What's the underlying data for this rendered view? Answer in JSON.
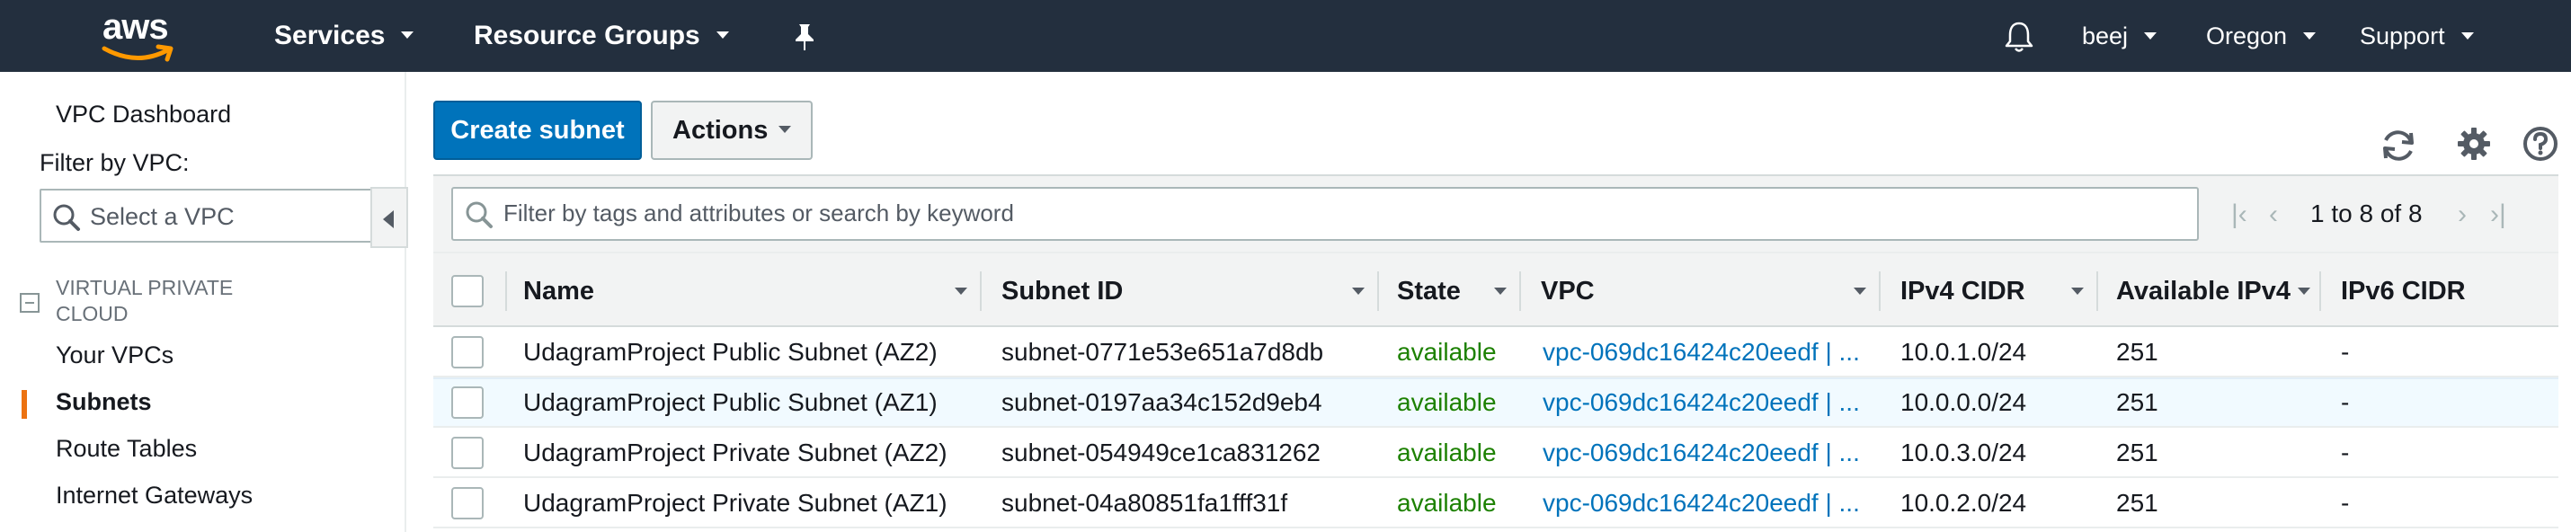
{
  "topnav": {
    "logo_text": "aws",
    "services": "Services",
    "resource_groups": "Resource Groups",
    "user": "beej",
    "region": "Oregon",
    "support": "Support",
    "pin_icon": "pushpin-icon",
    "bell_icon": "bell-icon"
  },
  "sidebar": {
    "dashboard": "VPC Dashboard",
    "filter_label": "Filter by VPC:",
    "vpc_select_placeholder": "Select a VPC",
    "section_title": "VIRTUAL PRIVATE CLOUD",
    "items": [
      {
        "label": "Your VPCs",
        "active": false
      },
      {
        "label": "Subnets",
        "active": true
      },
      {
        "label": "Route Tables",
        "active": false
      },
      {
        "label": "Internet Gateways",
        "active": false
      }
    ]
  },
  "toolbar": {
    "create_label": "Create subnet",
    "actions_label": "Actions",
    "icons": [
      "refresh-icon",
      "settings-gear-icon",
      "help-icon"
    ]
  },
  "filter": {
    "placeholder": "Filter by tags and attributes or search by keyword",
    "pagination": "1 to 8 of 8"
  },
  "table": {
    "columns": [
      "Name",
      "Subnet ID",
      "State",
      "VPC",
      "IPv4 CIDR",
      "Available IPv4 ...",
      "IPv6 CIDR"
    ],
    "rows": [
      {
        "name": "UdagramProject Public Subnet (AZ2)",
        "subnet_id": "subnet-0771e53e651a7d8db",
        "state": "available",
        "vpc": "vpc-069dc16424c20eedf | ...",
        "ipv4": "10.0.1.0/24",
        "available": "251",
        "ipv6": "-"
      },
      {
        "name": "UdagramProject Public Subnet (AZ1)",
        "subnet_id": "subnet-0197aa34c152d9eb4",
        "state": "available",
        "vpc": "vpc-069dc16424c20eedf | ...",
        "ipv4": "10.0.0.0/24",
        "available": "251",
        "ipv6": "-"
      },
      {
        "name": "UdagramProject Private Subnet (AZ2)",
        "subnet_id": "subnet-054949ce1ca831262",
        "state": "available",
        "vpc": "vpc-069dc16424c20eedf | ...",
        "ipv4": "10.0.3.0/24",
        "available": "251",
        "ipv6": "-"
      },
      {
        "name": "UdagramProject Private Subnet (AZ1)",
        "subnet_id": "subnet-04a80851fa1fff31f",
        "state": "available",
        "vpc": "vpc-069dc16424c20eedf | ...",
        "ipv4": "10.0.2.0/24",
        "available": "251",
        "ipv6": "-"
      }
    ]
  },
  "colors": {
    "nav_bg": "#232f3e",
    "primary": "#0073bb",
    "status_available": "#1d8102",
    "active_indicator": "#ec7211"
  }
}
